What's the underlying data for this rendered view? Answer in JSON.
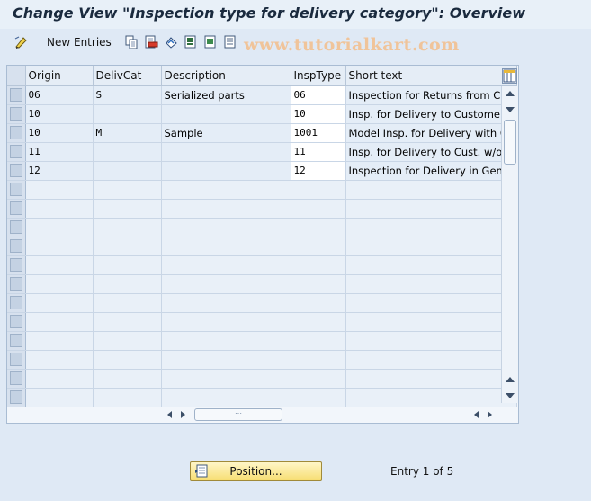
{
  "window": {
    "title": "Change View \"Inspection type for delivery category\": Overview"
  },
  "toolbar": {
    "items": [
      {
        "icon": "display-change-icon",
        "label": ""
      },
      {
        "icon": "new-entries-icon",
        "label": "New Entries"
      },
      {
        "icon": "copy-icon",
        "label": ""
      },
      {
        "icon": "delete-icon",
        "label": ""
      },
      {
        "icon": "undo-icon",
        "label": ""
      },
      {
        "icon": "select-all-icon",
        "label": ""
      },
      {
        "icon": "select-block-icon",
        "label": ""
      },
      {
        "icon": "deselect-all-icon",
        "label": ""
      }
    ]
  },
  "watermark": "www.tutorialkart.com",
  "table": {
    "columns": [
      "Origin",
      "DelivCat",
      "Description",
      "InspType",
      "Short text"
    ],
    "rows": [
      {
        "origin": "06",
        "delivcat": "S",
        "description": "Serialized parts",
        "insptype": "06",
        "short_text": "Inspection for Returns from Cus"
      },
      {
        "origin": "10",
        "delivcat": "",
        "description": "",
        "insptype": "10",
        "short_text": "Insp. for Delivery to Customer w"
      },
      {
        "origin": "10",
        "delivcat": "M",
        "description": "Sample",
        "insptype": "1001",
        "short_text": "Model Insp. for Delivery with Or"
      },
      {
        "origin": "11",
        "delivcat": "",
        "description": "",
        "insptype": "11",
        "short_text": "Insp. for Delivery to Cust. w/o c"
      },
      {
        "origin": "12",
        "delivcat": "",
        "description": "",
        "insptype": "12",
        "short_text": "Inspection for Delivery in Gener"
      }
    ],
    "empty_rows": 12
  },
  "footer": {
    "position_button": "Position...",
    "entry_info": "Entry 1 of 5"
  }
}
